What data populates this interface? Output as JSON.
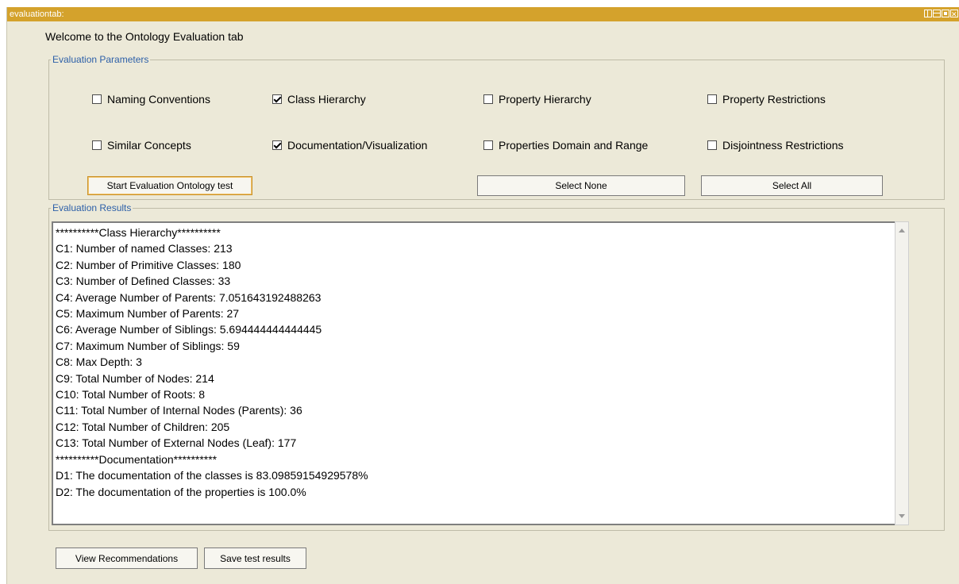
{
  "window": {
    "title": "evaluationtab:"
  },
  "welcome": "Welcome to the Ontology Evaluation tab",
  "parameters": {
    "legend": "Evaluation Parameters",
    "checkboxes": [
      {
        "label": "Naming Conventions",
        "checked": false
      },
      {
        "label": "Class Hierarchy",
        "checked": true
      },
      {
        "label": "Property Hierarchy",
        "checked": false
      },
      {
        "label": "Property Restrictions",
        "checked": false
      },
      {
        "label": "Similar Concepts",
        "checked": false
      },
      {
        "label": "Documentation/Visualization",
        "checked": true
      },
      {
        "label": "Properties Domain and Range",
        "checked": false
      },
      {
        "label": "Disjointness Restrictions",
        "checked": false
      }
    ],
    "start_button": "Start Evaluation Ontology test",
    "select_none": "Select None",
    "select_all": "Select All"
  },
  "results": {
    "legend": "Evaluation Results",
    "lines": [
      "**********Class Hierarchy**********",
      "C1: Number of named Classes: 213",
      "C2: Number of Primitive Classes: 180",
      "C3: Number of Defined Classes: 33",
      "C4: Average Number of Parents: 7.051643192488263",
      "C5: Maximum Number of Parents: 27",
      "C6: Average Number of Siblings: 5.694444444444445",
      "C7: Maximum Number of Siblings: 59",
      "C8: Max Depth: 3",
      "C9: Total Number of Nodes: 214",
      "C10: Total Number of Roots: 8",
      "C11: Total Number of Internal Nodes (Parents): 36",
      "C12: Total Number of Children: 205",
      "C13: Total Number of External Nodes (Leaf): 177",
      "**********Documentation**********",
      "D1: The documentation of the classes is 83.09859154929578%",
      "D2: The documentation of the properties is 100.0%"
    ]
  },
  "footer": {
    "view_recommendations": "View Recommendations",
    "save_results": "Save test results"
  }
}
